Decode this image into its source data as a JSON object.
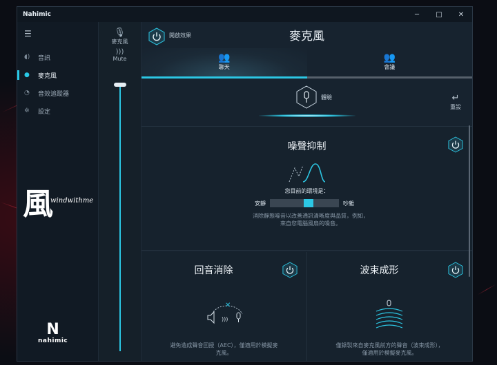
{
  "window": {
    "title": "Nahimic",
    "controls": [
      "─",
      "□",
      "✕"
    ]
  },
  "sidebar": {
    "items": [
      {
        "label": "音訊",
        "icon": "speaker-icon",
        "glyph": "◖)"
      },
      {
        "label": "麥克風",
        "icon": "microphone-icon",
        "glyph": "●"
      },
      {
        "label": "音效追蹤器",
        "icon": "sound-tracker-icon",
        "glyph": "◔"
      },
      {
        "label": "設定",
        "icon": "gear-icon",
        "glyph": "✲"
      }
    ],
    "active_index": 1,
    "signature_kanji": "風",
    "signature_script": "windwithme",
    "brand": "nahimic",
    "brand_mark": "N"
  },
  "device": {
    "label": "麥克風",
    "mute_label": "Mute",
    "volume_percent": 100
  },
  "header": {
    "master_label": "開啟效果",
    "title": "麥克風"
  },
  "tabs": [
    {
      "label": "聊天",
      "active": true
    },
    {
      "label": "會議",
      "active": false
    }
  ],
  "profile": {
    "label": "體驗",
    "reset_label": "重設"
  },
  "noise": {
    "title": "噪聲抑制",
    "env_prompt": "您目前的環境是：",
    "left_label": "安靜",
    "right_label": "吵雜",
    "level_fraction": 0.57,
    "description": "消除靜態噪音以改善通訊清晰度與品質，例如，來自您電腦風扇的噪音。"
  },
  "echo": {
    "title": "回音消除",
    "description": "避免造成聲音回授（AEC），僅適用於模擬麥克風。"
  },
  "beam": {
    "title": "波束成形",
    "description": "僅錄製來自麥克風前方的聲音（波束成形），僅適用於模擬麥克風。"
  },
  "colors": {
    "accent": "#2cc7e4",
    "panel": "#16222d",
    "sidebar": "#111a24"
  }
}
